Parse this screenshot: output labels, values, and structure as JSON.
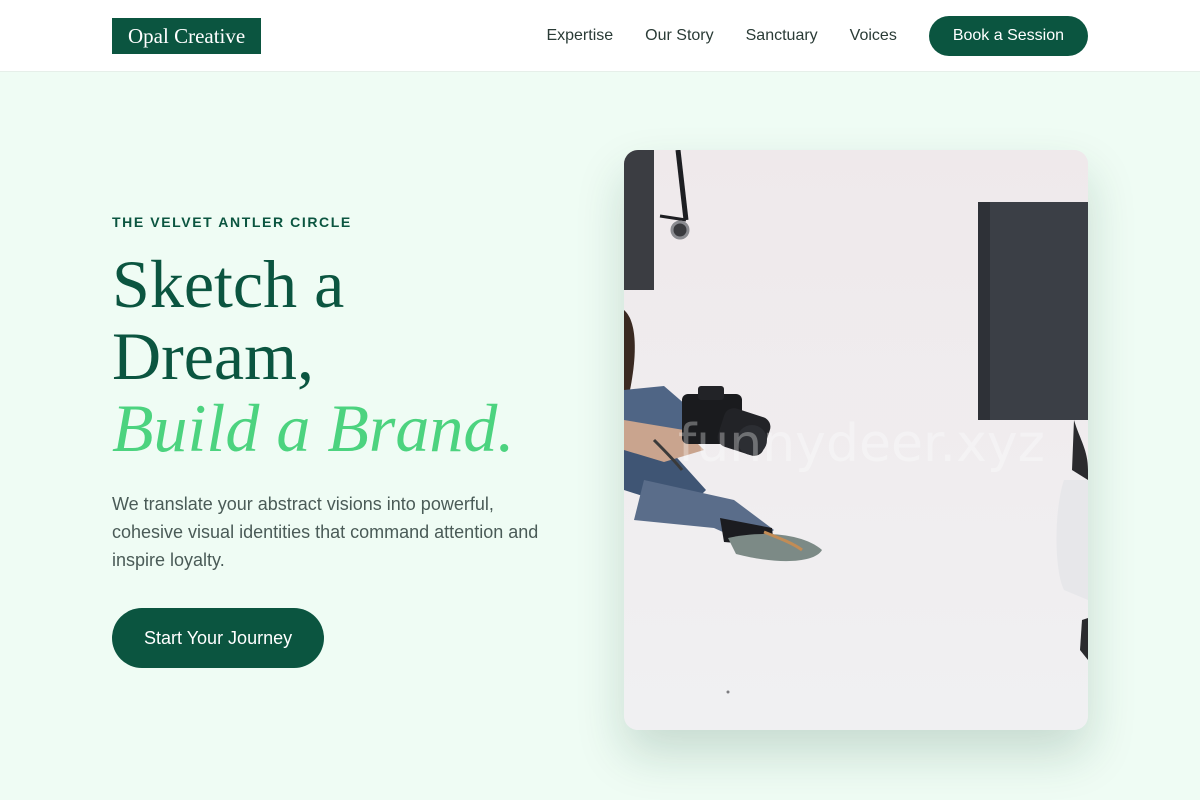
{
  "brand": {
    "logo_text": "Opal Creative"
  },
  "nav": {
    "links": [
      "Expertise",
      "Our Story",
      "Sanctuary",
      "Voices"
    ],
    "cta_label": "Book a Session"
  },
  "hero": {
    "eyebrow": "THE VELVET ANTLER CIRCLE",
    "headline_line1": "Sketch a",
    "headline_line2": "Dream,",
    "headline_accent": "Build a Brand.",
    "lead": "We translate your abstract visions into powerful, cohesive visual identities that command attention and inspire loyalty.",
    "cta_label": "Start Your Journey"
  },
  "photo": {
    "watermark": "funnydeer.xyz"
  },
  "colors": {
    "brand_green": "#0b5540",
    "accent_green": "#4cd37f",
    "page_bg": "#effcf4"
  }
}
